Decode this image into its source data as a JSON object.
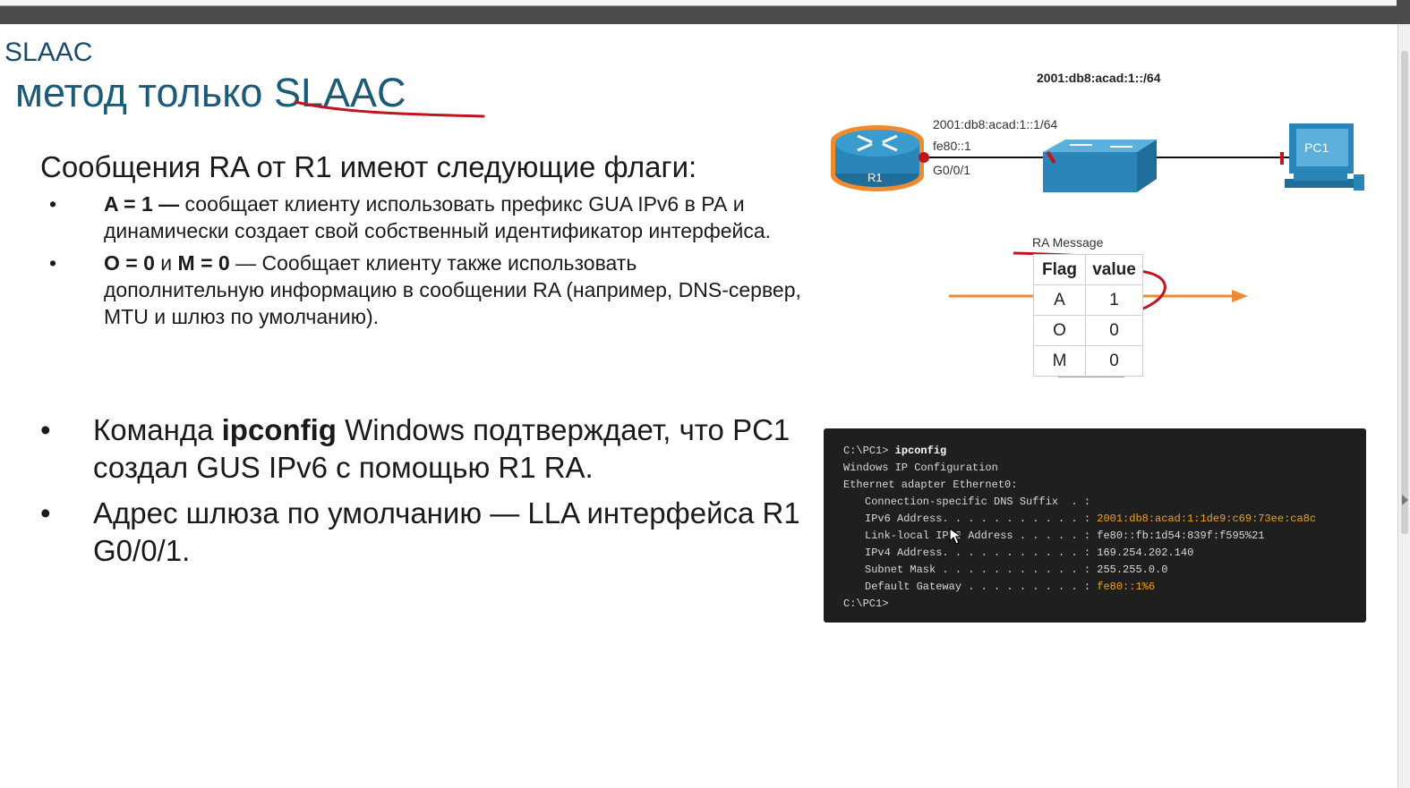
{
  "slide": {
    "section": "SLAAC",
    "title": "метод только SLAAC",
    "heading": "Сообщения RA от R1 имеют следующие флаги:",
    "bullet_symbol": "•",
    "bullets_small": [
      {
        "bold": "A = 1 —",
        "text": " сообщает клиенту использовать префикс GUA IPv6 в РА и динамически создает свой собственный идентификатор интерфейса."
      },
      {
        "bold1": "O = 0",
        "mid": " и ",
        "bold2": "M = 0",
        "text": " — Сообщает клиенту также использовать дополнительную информацию в сообщении RA (например, DNS-сервер, MTU и шлюз по умолчанию)."
      }
    ],
    "bullets_big": [
      {
        "pre": "Команда ",
        "bold": "ipconfig",
        "text": " Windows подтверждает, что PC1 создал GUS IPv6 с помощью R1 RA."
      },
      {
        "text": "Адрес шлюза по умолчанию — LLA интерфейса R1 G0/0/1."
      }
    ]
  },
  "diagram": {
    "subnet": "2001:db8:acad:1::/64",
    "r1_gua": "2001:db8:acad:1::1/64",
    "r1_lla": "fe80::1",
    "r1_interface": "G0/0/1",
    "router_label": "R1",
    "pc_label": "PC1",
    "ra_message": {
      "title": "RA Message",
      "headers": [
        "Flag",
        "value"
      ],
      "rows": [
        [
          "A",
          "1"
        ],
        [
          "O",
          "0"
        ],
        [
          "M",
          "0"
        ]
      ]
    },
    "colors": {
      "arrow": "#f08a30",
      "annotation": "#c0141e",
      "device": "#2a86b8"
    }
  },
  "terminal": {
    "prompt": "C:\\PC1>",
    "command": "ipconfig",
    "line1": "Windows IP Configuration",
    "line2": "Ethernet adapter Ethernet0:",
    "dns_label": "Connection-specific DNS Suffix  . :",
    "ipv6_label": "IPv6 Address. . . . . . . . . . . :",
    "ipv6_value": "2001:db8:acad:1:1de9:c69:73ee:ca8c",
    "lla_label": "Link-local IPv6 Address . . . . . :",
    "lla_value": "fe80::fb:1d54:839f:f595%21",
    "ipv4_label": "IPv4 Address. . . . . . . . . . . :",
    "ipv4_value": "169.254.202.140",
    "mask_label": "Subnet Mask . . . . . . . . . . . :",
    "mask_value": "255.255.0.0",
    "gw_label": "Default Gateway . . . . . . . . . :",
    "gw_value": "fe80::1%6",
    "final_prompt": "C:\\PC1>"
  }
}
